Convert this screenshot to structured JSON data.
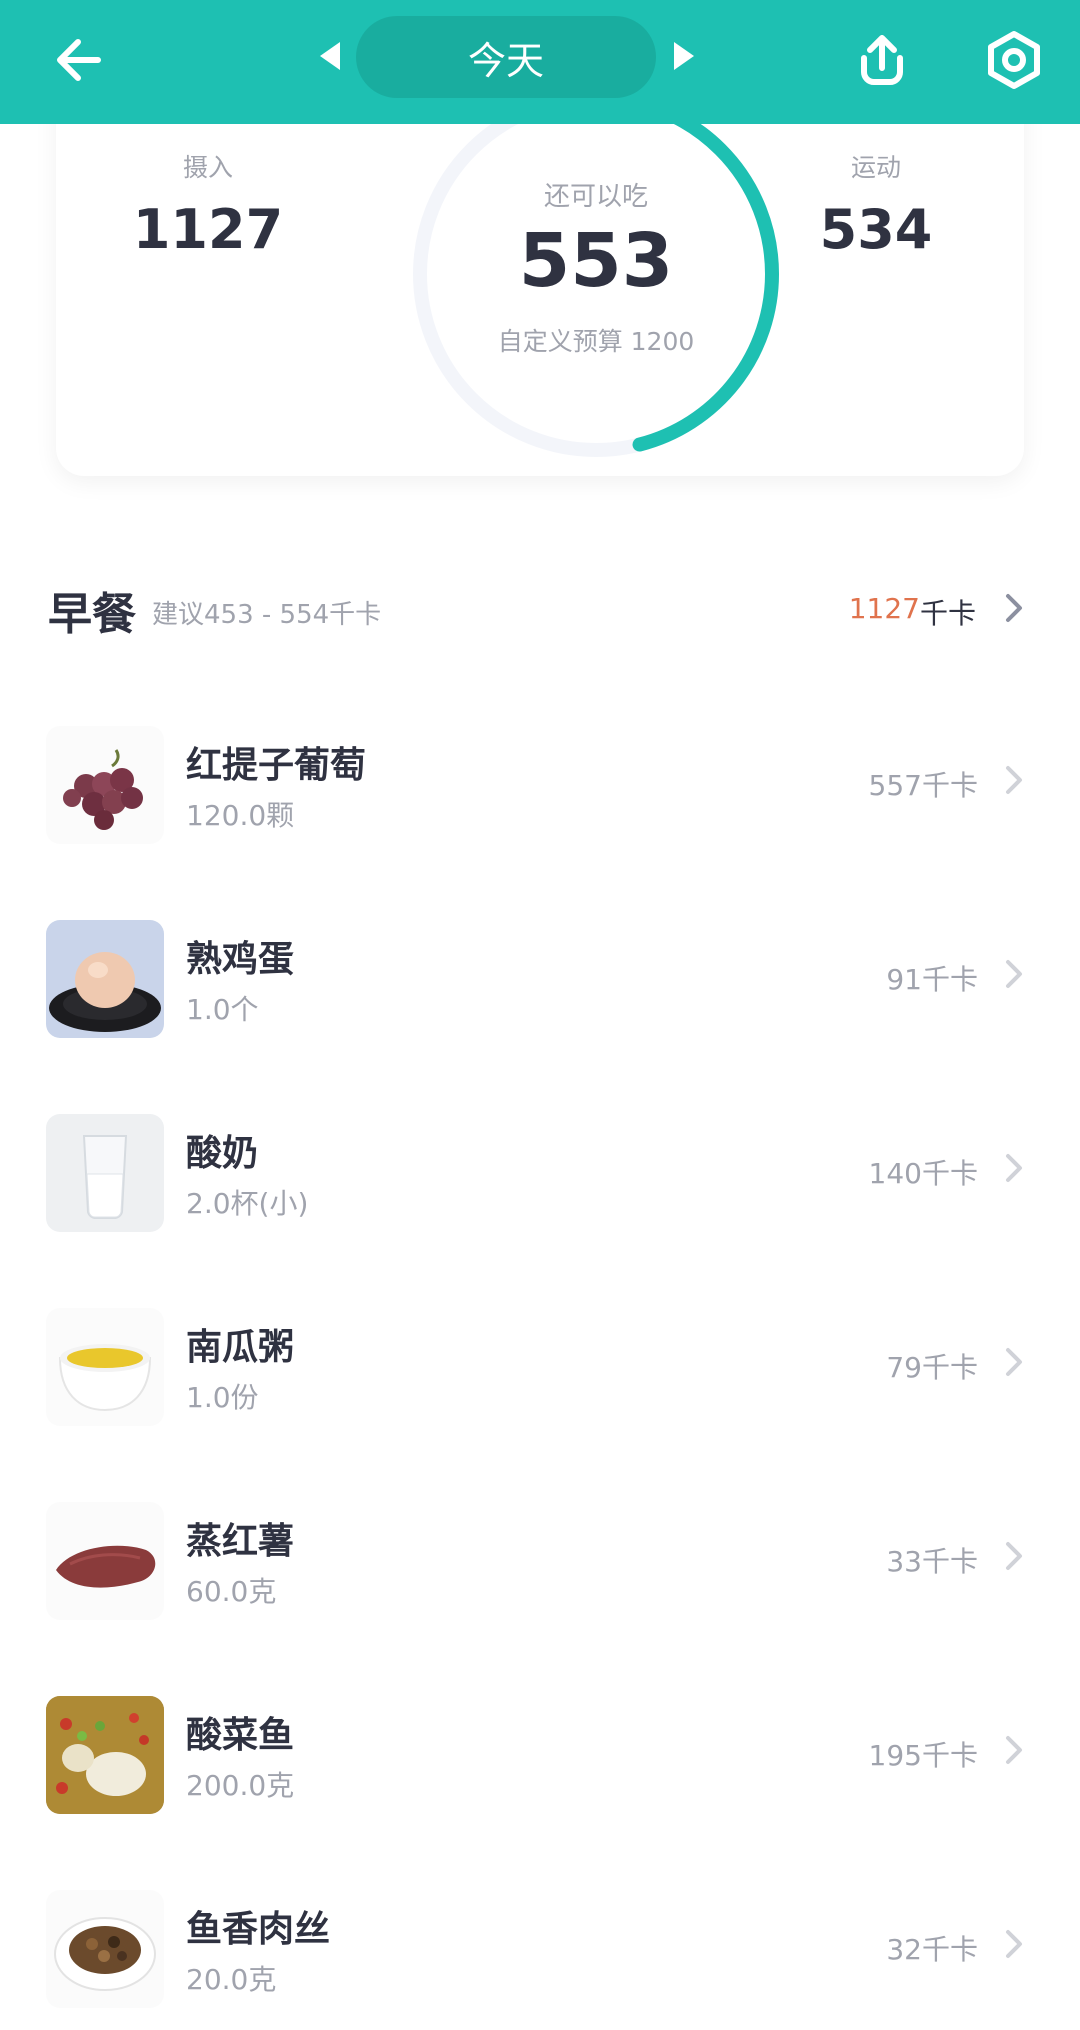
{
  "header": {
    "date_label": "今天",
    "back_icon": "arrow-left-icon",
    "share_icon": "share-upload-icon",
    "settings_icon": "settings-hex-icon",
    "colors": {
      "bar": "#1ec0b2",
      "pill": "#19ad9f"
    }
  },
  "summary": {
    "intake_label": "摄入",
    "intake_value": "1127",
    "exercise_label": "运动",
    "exercise_value": "534",
    "remaining_label": "还可以吃",
    "remaining_value": "553",
    "budget_label": "自定义预算 1200",
    "ring_progress": 0.46,
    "ring_color": "#1ec0b2"
  },
  "meal": {
    "title": "早餐",
    "suggestion": "建议453 - 554千卡",
    "kcal": "1127",
    "unit": "千卡",
    "kcal_color": "#e0734d"
  },
  "foods": [
    {
      "name": "红提子葡萄",
      "portion": "120.0颗",
      "kcal": "557千卡",
      "icon": "grapes-icon"
    },
    {
      "name": "熟鸡蛋",
      "portion": "1.0个",
      "kcal": "91千卡",
      "icon": "egg-icon"
    },
    {
      "name": "酸奶",
      "portion": "2.0杯(小)",
      "kcal": "140千卡",
      "icon": "yogurt-icon"
    },
    {
      "name": "南瓜粥",
      "portion": "1.0份",
      "kcal": "79千卡",
      "icon": "pumpkin-porridge-icon"
    },
    {
      "name": "蒸红薯",
      "portion": "60.0克",
      "kcal": "33千卡",
      "icon": "sweet-potato-icon"
    },
    {
      "name": "酸菜鱼",
      "portion": "200.0克",
      "kcal": "195千卡",
      "icon": "pickled-fish-icon"
    },
    {
      "name": "鱼香肉丝",
      "portion": "20.0克",
      "kcal": "32千卡",
      "icon": "shredded-pork-icon"
    }
  ]
}
